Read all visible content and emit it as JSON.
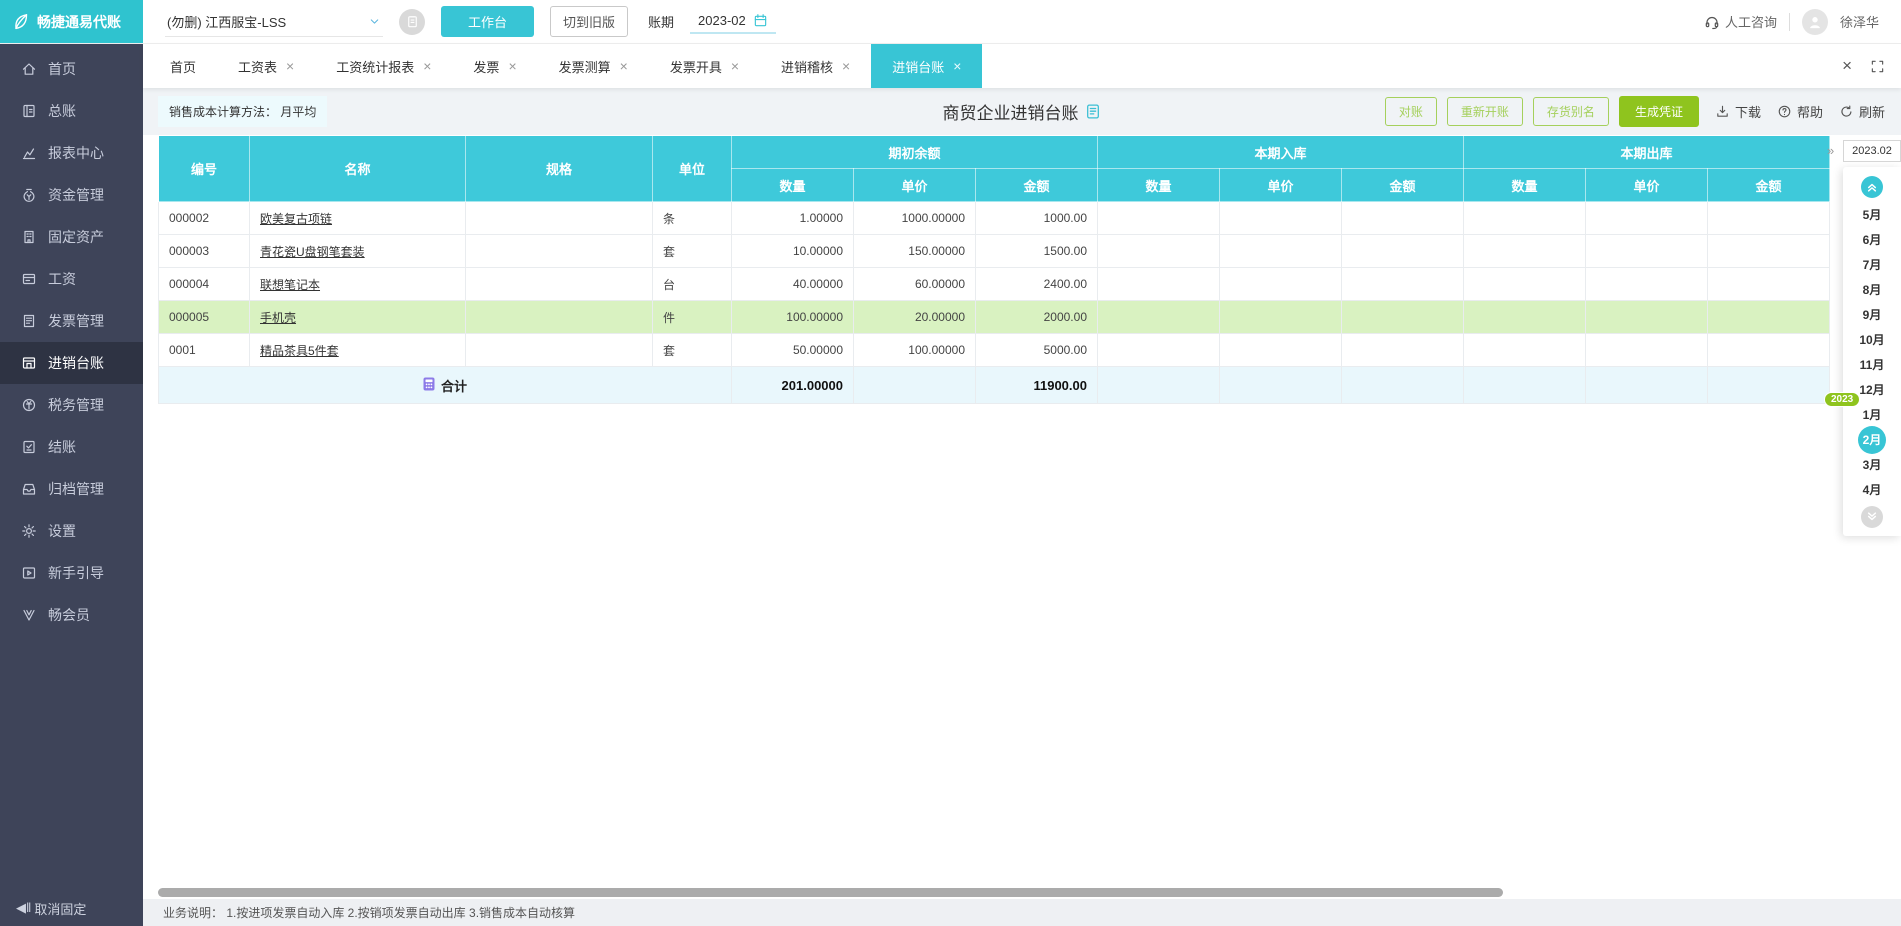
{
  "topbar": {
    "logo_text": "畅捷通易代账",
    "company_selector": "(勿删) 江西服宝-LSS",
    "workbench_button": "工作台",
    "switch_old_button": "切到旧版",
    "period_label": "账期",
    "period_value": "2023-02",
    "consult_label": "人工咨询",
    "username": "徐泽华"
  },
  "sidebar": {
    "items": [
      {
        "id": "home",
        "icon": "home",
        "label": "首页",
        "active": false
      },
      {
        "id": "general-ledger",
        "icon": "general-ledger",
        "label": "总账",
        "active": false
      },
      {
        "id": "report-center",
        "icon": "report-center",
        "label": "报表中心",
        "active": false
      },
      {
        "id": "funds",
        "icon": "funds",
        "label": "资金管理",
        "active": false
      },
      {
        "id": "fixed-assets",
        "icon": "fixed-assets",
        "label": "固定资产",
        "active": false
      },
      {
        "id": "payroll",
        "icon": "payroll",
        "label": "工资",
        "active": false
      },
      {
        "id": "invoice-mgmt",
        "icon": "invoice-mgmt",
        "label": "发票管理",
        "active": false
      },
      {
        "id": "purchase-sale-ledger",
        "icon": "purchase-sale-ledger",
        "label": "进销台账",
        "active": true
      },
      {
        "id": "tax-mgmt",
        "icon": "tax-mgmt",
        "label": "税务管理",
        "active": false
      },
      {
        "id": "closing",
        "icon": "closing",
        "label": "结账",
        "active": false
      },
      {
        "id": "archive",
        "icon": "archive",
        "label": "归档管理",
        "active": false
      },
      {
        "id": "settings",
        "icon": "settings",
        "label": "设置",
        "active": false
      },
      {
        "id": "guide",
        "icon": "guide",
        "label": "新手引导",
        "active": false
      },
      {
        "id": "member",
        "icon": "member",
        "label": "畅会员",
        "active": false
      }
    ],
    "unpin_label": "取消固定"
  },
  "tabs": [
    {
      "id": "home",
      "label": "首页",
      "closable": false,
      "active": false
    },
    {
      "id": "payroll-sheet",
      "label": "工资表",
      "closable": true,
      "active": false
    },
    {
      "id": "payroll-report",
      "label": "工资统计报表",
      "closable": true,
      "active": false
    },
    {
      "id": "invoice",
      "label": "发票",
      "closable": true,
      "active": false
    },
    {
      "id": "invoice-calc",
      "label": "发票测算",
      "closable": true,
      "active": false
    },
    {
      "id": "invoice-issue",
      "label": "发票开具",
      "closable": true,
      "active": false
    },
    {
      "id": "purchase-sale-audit",
      "label": "进销稽核",
      "closable": true,
      "active": false
    },
    {
      "id": "purchase-sale-ledger",
      "label": "进销台账",
      "closable": true,
      "active": true
    }
  ],
  "toolbar": {
    "cost_method": "销售成本计算方法：  月平均",
    "title": "商贸企业进销台账",
    "action_buttons": [
      {
        "id": "reconcile",
        "label": "对账",
        "style": "outline"
      },
      {
        "id": "reopen",
        "label": "重新开账",
        "style": "outline"
      },
      {
        "id": "stock-alias",
        "label": "存货别名",
        "style": "outline"
      },
      {
        "id": "generate-voucher",
        "label": "生成凭证",
        "style": "solid"
      }
    ],
    "links": [
      {
        "id": "download",
        "icon": "download",
        "label": "下载"
      },
      {
        "id": "help",
        "icon": "help",
        "label": "帮助"
      },
      {
        "id": "refresh",
        "icon": "refresh",
        "label": "刷新"
      }
    ]
  },
  "table": {
    "columns": [
      "编号",
      "名称",
      "规格",
      "单位"
    ],
    "groups": [
      "期初余额",
      "本期入库",
      "本期出库"
    ],
    "subcolumns": [
      "数量",
      "单价",
      "金额"
    ],
    "rows": [
      {
        "code": "000002",
        "name": "欧美复古项链",
        "spec": "",
        "unit": "条",
        "begin": {
          "qty": "1.00000",
          "price": "1000.00000",
          "amount": "1000.00"
        },
        "in": {
          "qty": "",
          "price": "",
          "amount": ""
        },
        "out": {
          "qty": "",
          "price": "",
          "amount": ""
        },
        "highlight": false
      },
      {
        "code": "000003",
        "name": "青花瓷U盘钢笔套装",
        "spec": "",
        "unit": "套",
        "begin": {
          "qty": "10.00000",
          "price": "150.00000",
          "amount": "1500.00"
        },
        "in": {
          "qty": "",
          "price": "",
          "amount": ""
        },
        "out": {
          "qty": "",
          "price": "",
          "amount": ""
        },
        "highlight": false
      },
      {
        "code": "000004",
        "name": "联想笔记本",
        "spec": "",
        "unit": "台",
        "begin": {
          "qty": "40.00000",
          "price": "60.00000",
          "amount": "2400.00"
        },
        "in": {
          "qty": "",
          "price": "",
          "amount": ""
        },
        "out": {
          "qty": "",
          "price": "",
          "amount": ""
        },
        "highlight": false
      },
      {
        "code": "000005",
        "name": "手机壳",
        "spec": "",
        "unit": "件",
        "begin": {
          "qty": "100.00000",
          "price": "20.00000",
          "amount": "2000.00"
        },
        "in": {
          "qty": "",
          "price": "",
          "amount": ""
        },
        "out": {
          "qty": "",
          "price": "",
          "amount": ""
        },
        "highlight": true
      },
      {
        "code": "0001",
        "name": "精品茶具5件套",
        "spec": "",
        "unit": "套",
        "begin": {
          "qty": "50.00000",
          "price": "100.00000",
          "amount": "5000.00"
        },
        "in": {
          "qty": "",
          "price": "",
          "amount": ""
        },
        "out": {
          "qty": "",
          "price": "",
          "amount": ""
        },
        "highlight": false
      }
    ],
    "total": {
      "label": "合计",
      "begin_qty": "201.00000",
      "begin_amount": "11900.00"
    }
  },
  "footer": {
    "note": "业务说明： 1.按进项发票自动入库   2.按销项发票自动出库   3.销售成本自动核算"
  },
  "month_panel": {
    "current_period": "2023.02",
    "collapse_glyph": "»",
    "year_badge": "2023",
    "badge_before_index": 8,
    "months": [
      "5月",
      "6月",
      "7月",
      "8月",
      "9月",
      "10月",
      "11月",
      "12月",
      "1月",
      "2月",
      "3月",
      "4月"
    ],
    "active_month": "2月"
  },
  "colors": {
    "primary_teal": "#38c5d5",
    "table_header_teal": "#3ec9da",
    "sidebar_bg": "#3e4459",
    "action_green": "#8fc41e",
    "highlight_row": "#d9f2c1",
    "total_row_bg": "#e9f7fc"
  }
}
